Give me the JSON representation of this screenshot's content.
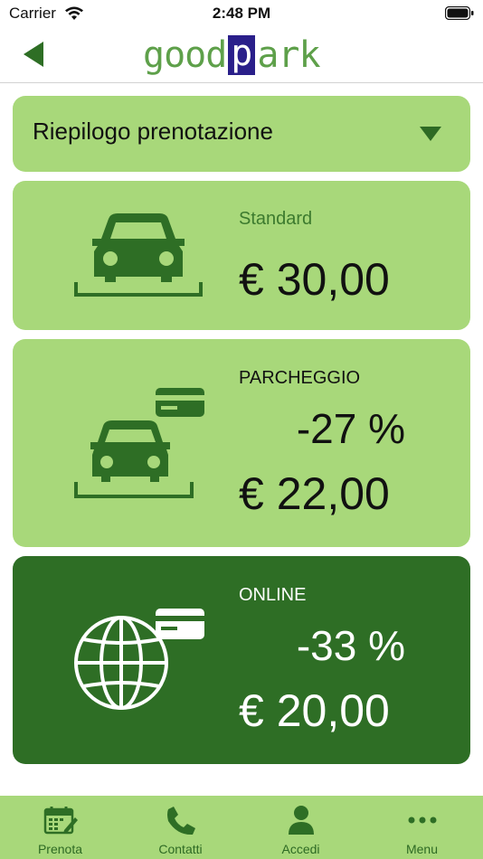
{
  "status_bar": {
    "carrier": "Carrier",
    "time": "2:48 PM"
  },
  "header": {
    "back_icon": "back-arrow-icon",
    "logo_left": "good",
    "logo_box": "p",
    "logo_right": "ark",
    "colors": {
      "logo_green": "#5ea04a",
      "logo_box": "#2a1f8a"
    }
  },
  "summary": {
    "label": "Riepilogo prenotazione",
    "icon": "chevron-down-icon"
  },
  "cards": [
    {
      "name": "Standard",
      "price": "€ 30,00",
      "discount": "",
      "icon": "car-parking-icon"
    },
    {
      "name": "PARCHEGGIO",
      "discount": "-27 %",
      "price": "€ 22,00",
      "icon": "car-parking-card-icon"
    },
    {
      "name": "ONLINE",
      "discount": "-33 %",
      "price": "€ 20,00",
      "icon": "globe-card-icon"
    }
  ],
  "tabbar": {
    "items": [
      {
        "label": "Prenota",
        "icon": "calendar-icon"
      },
      {
        "label": "Contatti",
        "icon": "phone-icon"
      },
      {
        "label": "Accedi",
        "icon": "user-icon"
      },
      {
        "label": "Menu",
        "icon": "more-icon"
      }
    ]
  },
  "colors": {
    "light_green": "#a8d87a",
    "dark_green": "#2e6e25",
    "icon_green": "#3c7a2e"
  }
}
